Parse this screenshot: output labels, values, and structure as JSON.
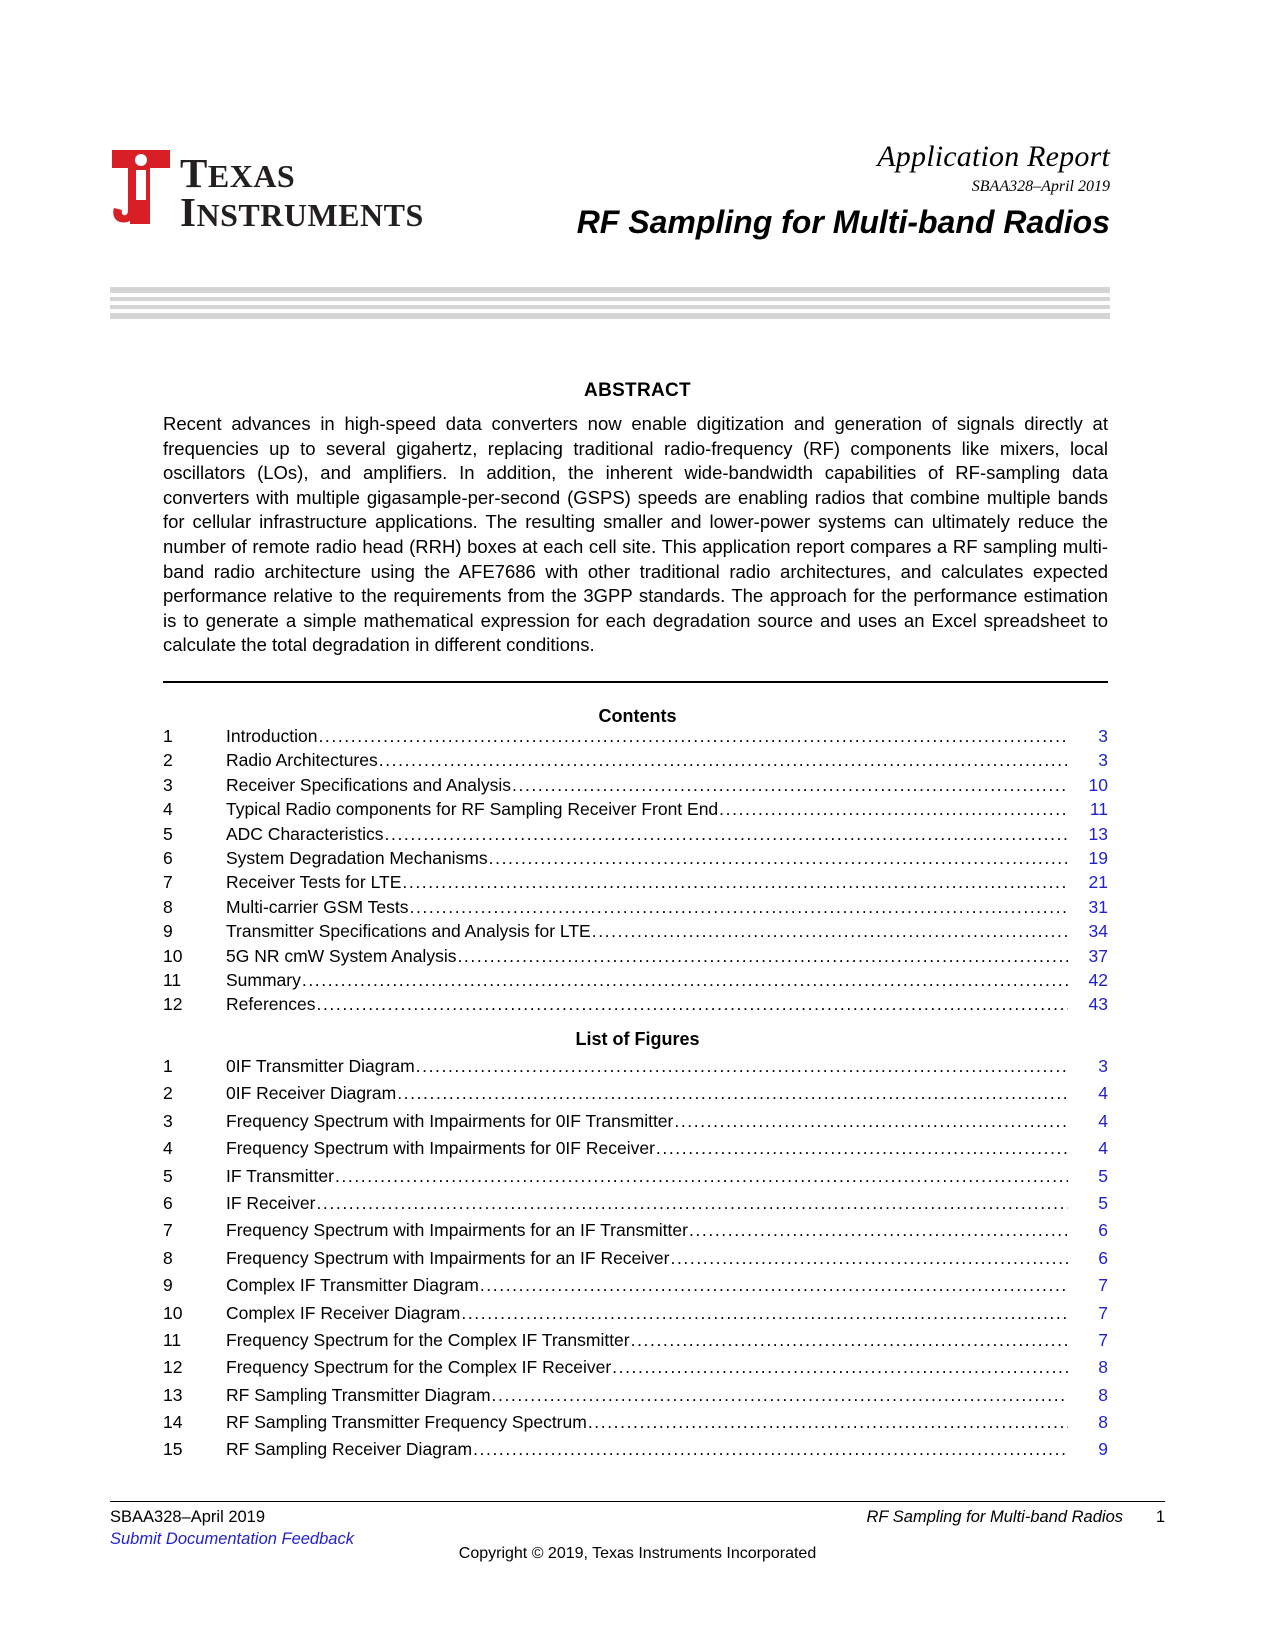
{
  "header": {
    "logo_alt": "Texas Instruments",
    "logo_line1": "TEXAS",
    "logo_line2": "INSTRUMENTS",
    "report_type": "Application Report",
    "doc_id": "SBAA328–April 2019",
    "doc_title": "RF Sampling for Multi-band Radios"
  },
  "abstract": {
    "heading": "ABSTRACT",
    "body": "Recent advances in high-speed data converters now enable digitization and generation of signals directly at frequencies up to several gigahertz, replacing traditional radio-frequency (RF) components like mixers, local oscillators (LOs), and amplifiers. In addition, the inherent wide-bandwidth capabilities of RF-sampling data converters with multiple gigasample-per-second (GSPS) speeds are enabling radios that combine multiple bands for cellular infrastructure applications. The resulting smaller and lower-power systems can ultimately reduce the number of remote radio head (RRH) boxes at each cell site. This application report compares a RF sampling multi-band radio architecture using the AFE7686 with other traditional radio architectures, and calculates expected performance relative to the requirements from the 3GPP standards. The approach for the performance estimation is to generate a simple mathematical expression for each degradation source and uses an Excel spreadsheet to calculate the total degradation in different conditions."
  },
  "contents": {
    "heading": "Contents",
    "entries": [
      {
        "num": "1",
        "label": "Introduction",
        "page": "3"
      },
      {
        "num": "2",
        "label": "Radio Architectures",
        "page": "3"
      },
      {
        "num": "3",
        "label": "Receiver Specifications and Analysis",
        "page": "10"
      },
      {
        "num": "4",
        "label": "Typical Radio components for RF Sampling Receiver Front End",
        "page": "11"
      },
      {
        "num": "5",
        "label": "ADC Characteristics",
        "page": "13"
      },
      {
        "num": "6",
        "label": "System Degradation Mechanisms",
        "page": "19"
      },
      {
        "num": "7",
        "label": "Receiver Tests for LTE",
        "page": "21"
      },
      {
        "num": "8",
        "label": "Multi-carrier GSM Tests",
        "page": "31"
      },
      {
        "num": "9",
        "label": "Transmitter Specifications and Analysis for LTE",
        "page": "34"
      },
      {
        "num": "10",
        "label": "5G NR cmW System Analysis",
        "page": "37"
      },
      {
        "num": "11",
        "label": "Summary",
        "page": "42"
      },
      {
        "num": "12",
        "label": "References",
        "page": "43"
      }
    ]
  },
  "figures": {
    "heading": "List of Figures",
    "entries": [
      {
        "num": "1",
        "label": "0IF Transmitter Diagram",
        "page": "3"
      },
      {
        "num": "2",
        "label": "0IF Receiver Diagram",
        "page": "4"
      },
      {
        "num": "3",
        "label": "Frequency Spectrum with Impairments for 0IF Transmitter",
        "page": "4"
      },
      {
        "num": "4",
        "label": "Frequency Spectrum with Impairments for 0IF Receiver",
        "page": "4"
      },
      {
        "num": "5",
        "label": "IF Transmitter",
        "page": "5"
      },
      {
        "num": "6",
        "label": "IF Receiver",
        "page": "5"
      },
      {
        "num": "7",
        "label": "Frequency Spectrum with Impairments for an IF Transmitter",
        "page": "6"
      },
      {
        "num": "8",
        "label": "Frequency Spectrum with Impairments for an IF Receiver",
        "page": "6"
      },
      {
        "num": "9",
        "label": "Complex IF Transmitter Diagram",
        "page": "7"
      },
      {
        "num": "10",
        "label": "Complex IF Receiver Diagram",
        "page": "7"
      },
      {
        "num": "11",
        "label": "Frequency Spectrum for the Complex IF Transmitter",
        "page": "7"
      },
      {
        "num": "12",
        "label": "Frequency Spectrum for the Complex IF Receiver",
        "page": "8"
      },
      {
        "num": "13",
        "label": "RF Sampling Transmitter Diagram",
        "page": "8"
      },
      {
        "num": "14",
        "label": "RF Sampling Transmitter Frequency Spectrum",
        "page": "8"
      },
      {
        "num": "15",
        "label": "RF Sampling Receiver Diagram",
        "page": "9"
      }
    ]
  },
  "footer": {
    "doc_id": "SBAA328–April 2019",
    "feedback_link": "Submit Documentation Feedback",
    "doc_title": "RF Sampling for Multi-band Radios",
    "page_number": "1",
    "copyright": "Copyright © 2019, Texas Instruments Incorporated"
  },
  "colors": {
    "link_blue": "#2222cc",
    "ti_red": "#cc0000",
    "rule_gray": "#d5d5d5"
  }
}
